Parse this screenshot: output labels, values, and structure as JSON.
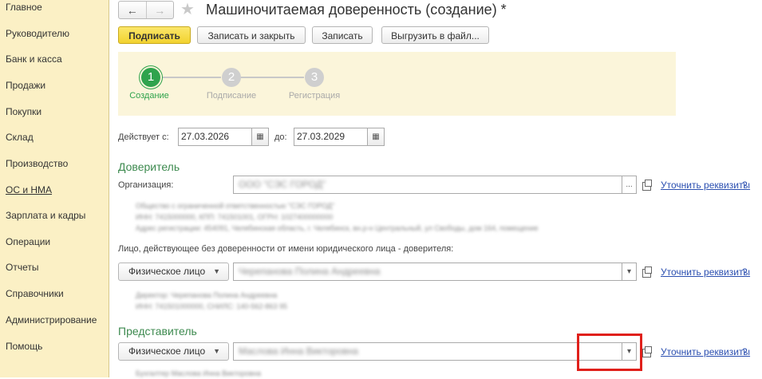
{
  "sidebar": {
    "items": [
      {
        "label": "Главное"
      },
      {
        "label": "Руководителю"
      },
      {
        "label": "Банк и касса"
      },
      {
        "label": "Продажи"
      },
      {
        "label": "Покупки"
      },
      {
        "label": "Склад"
      },
      {
        "label": "Производство"
      },
      {
        "label": "ОС и НМА"
      },
      {
        "label": "Зарплата и кадры"
      },
      {
        "label": "Операции"
      },
      {
        "label": "Отчеты"
      },
      {
        "label": "Справочники"
      },
      {
        "label": "Администрирование"
      },
      {
        "label": "Помощь"
      }
    ]
  },
  "header": {
    "back": "←",
    "forward": "→",
    "star": "★",
    "title": "Машиночитаемая доверенность (создание) *"
  },
  "toolbar": {
    "sign": "Подписать",
    "save_close": "Записать и закрыть",
    "save": "Записать",
    "export": "Выгрузить в файл..."
  },
  "steps": [
    {
      "num": "1",
      "label": "Создание",
      "active": true
    },
    {
      "num": "2",
      "label": "Подписание",
      "active": false
    },
    {
      "num": "3",
      "label": "Регистрация",
      "active": false
    }
  ],
  "validity": {
    "from_label": "Действует с:",
    "from_value": "27.03.2026",
    "to_label": "до:",
    "to_value": "27.03.2029",
    "calendar_icon": "calendar-icon"
  },
  "principal": {
    "heading": "Доверитель",
    "org_label": "Организация:",
    "org_value": "ООО \"СЭС ГОРОД\"",
    "details_link": "Уточнить реквизиты",
    "help": "?",
    "org_details": [
      "Общество с ограниченной ответственностью \"СЭС ГОРОД\"",
      "ИНН: 7415000000, КПП: 741501001, ОГРН: 1027400000000",
      "Адрес регистрации: 454091, Челябинская область, г. Челябинск, вн.р-н Центральный, ул Свободы, дом 164, помещение"
    ],
    "person_label": "Лицо, действующее без доверенности от имени юридического лица - доверителя:",
    "person_type": "Физическое лицо",
    "person_value": "Черепанова Полина Андреевна",
    "person_details": [
      "Директор: Черепанова Полина Андреевна",
      "ИНН: 741501000000, СНИЛС: 140-562-863 95"
    ]
  },
  "representative": {
    "heading": "Представитель",
    "person_type": "Физическое лицо",
    "person_value": "Маслова Инна Викторовна",
    "details_link": "Уточнить реквизиты",
    "help": "?",
    "details": "Бухгалтер Маслова Инна Викторовна"
  },
  "colors": {
    "sidebar_bg": "#fbf0c5",
    "accent_green": "#2fa34d",
    "primary_button": "#f2d22f",
    "link": "#2b4fb0",
    "highlight": "#e0201b"
  }
}
